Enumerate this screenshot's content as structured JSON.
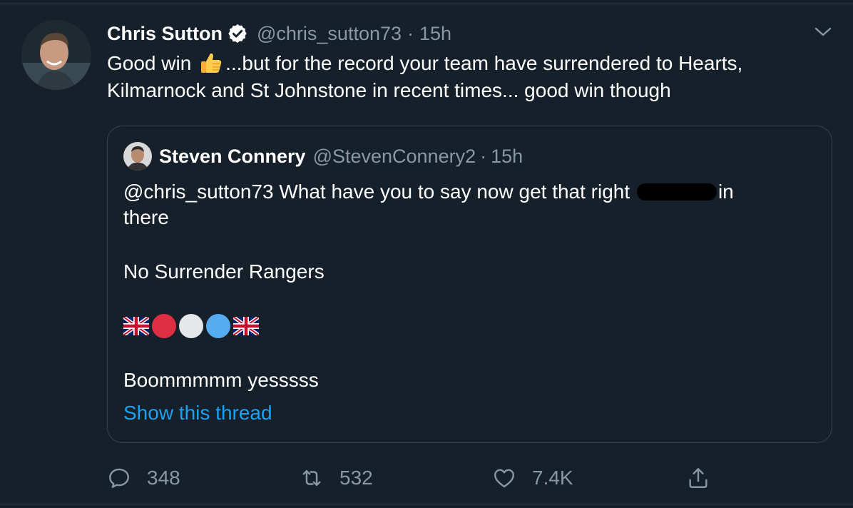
{
  "tweet": {
    "display_name": "Chris Sutton",
    "handle": "@chris_sutton73",
    "separator": "·",
    "time": "15h",
    "text_before_emoji": "Good win ",
    "text_after_emoji": "...but for the record your team have surrendered to Hearts, Kilmarnock and St Johnstone in recent times... good win though",
    "emoji_icon": "thumbs-up-icon"
  },
  "quote": {
    "display_name": "Steven Connery",
    "handle": "@StevenConnery2",
    "separator": "·",
    "time": "15h",
    "line1_before": "@chris_sutton73 What have you to say now get that right ",
    "line1_after": "in",
    "line2": "there",
    "line3": "No Surrender Rangers",
    "emoji_sequence": [
      "uk-flag-icon",
      "red-circle-icon",
      "white-circle-icon",
      "blue-circle-icon",
      "uk-flag-icon"
    ],
    "line4": "Boommmmm yesssss",
    "show_thread": "Show this thread"
  },
  "actions": {
    "replies": "348",
    "retweets": "532",
    "likes": "7.4K"
  },
  "colors": {
    "background": "#15202b",
    "border": "#38444d",
    "secondary_text": "#8899a6",
    "link": "#1da1f2"
  }
}
